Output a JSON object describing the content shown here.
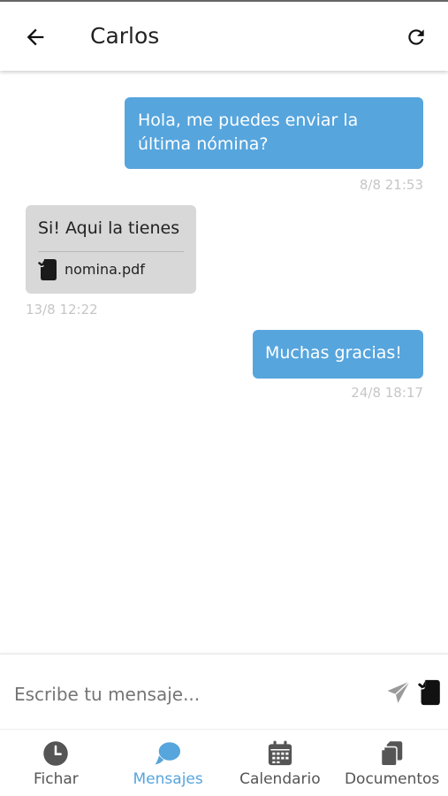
{
  "header": {
    "title": "Carlos",
    "back_icon": "arrow-left-icon",
    "refresh_icon": "refresh-icon"
  },
  "messages": [
    {
      "direction": "sent",
      "text": "Hola, me puedes enviar la última nómina?",
      "time": "8/8 21:53"
    },
    {
      "direction": "received",
      "text": "Si! Aqui la tienes",
      "attachment": {
        "icon": "file-icon",
        "name": "nomina.pdf"
      },
      "time": "13/8 12:22"
    },
    {
      "direction": "sent",
      "text": "Muchas gracias!",
      "time": "24/8 18:17"
    }
  ],
  "composer": {
    "placeholder": "Escribe tu mensaje...",
    "value": "",
    "send_icon": "send-icon",
    "attach_icon": "attach-file-icon"
  },
  "bottom_nav": [
    {
      "label": "Fichar",
      "icon": "clock-icon",
      "active": false
    },
    {
      "label": "Mensajes",
      "icon": "chat-icon",
      "active": true
    },
    {
      "label": "Calendario",
      "icon": "calendar-icon",
      "active": false
    },
    {
      "label": "Documentos",
      "icon": "documents-icon",
      "active": false
    }
  ],
  "colors": {
    "accent": "#56a5dd",
    "sent_bubble": "#56a5dd",
    "received_bubble": "#d8d8d8",
    "timestamp": "#c6c6c6"
  }
}
